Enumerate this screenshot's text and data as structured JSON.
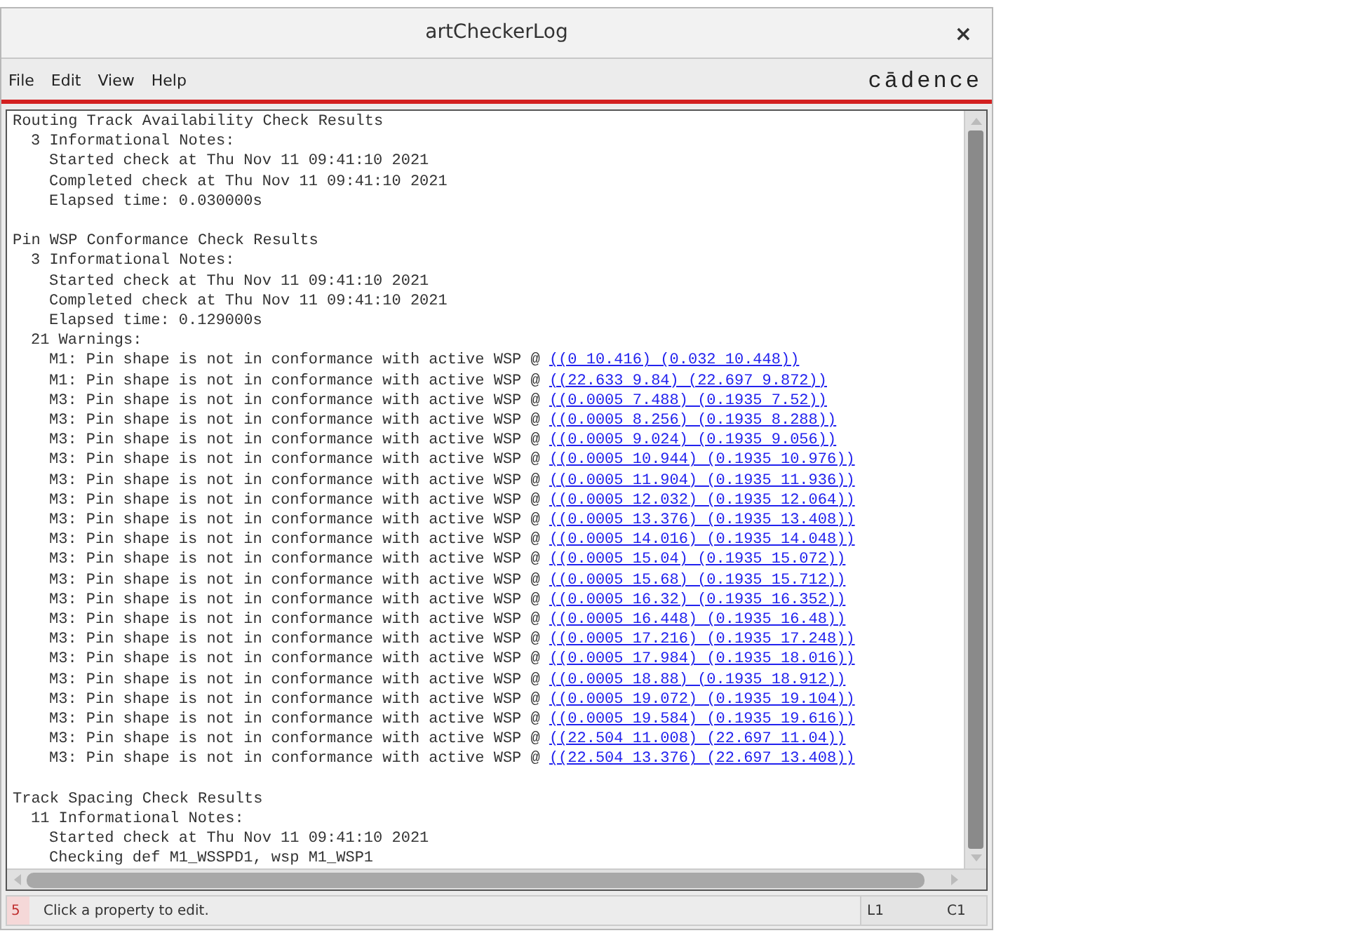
{
  "window": {
    "title": "artCheckerLog",
    "close": "×"
  },
  "menu": [
    {
      "label": "File"
    },
    {
      "label": "Edit"
    },
    {
      "label": "View"
    },
    {
      "label": "Help"
    }
  ],
  "logo": "cādence",
  "log": {
    "sections": [
      {
        "title": "Routing Track Availability Check Results",
        "groups": [
          {
            "heading": "3 Informational Notes:",
            "lines": [
              {
                "text": "Started check at Thu Nov 11 09:41:10 2021"
              },
              {
                "text": "Completed check at Thu Nov 11 09:41:10 2021"
              },
              {
                "text": "Elapsed time: 0.030000s"
              }
            ]
          }
        ]
      },
      {
        "title": "Pin WSP Conformance Check Results",
        "groups": [
          {
            "heading": "3 Informational Notes:",
            "lines": [
              {
                "text": "Started check at Thu Nov 11 09:41:10 2021"
              },
              {
                "text": "Completed check at Thu Nov 11 09:41:10 2021"
              },
              {
                "text": "Elapsed time: 0.129000s"
              }
            ]
          },
          {
            "heading": "21 Warnings:",
            "lines": [
              {
                "text": "M1: Pin shape is not in conformance with active WSP @",
                "link": "((0 10.416) (0.032 10.448))"
              },
              {
                "text": "M1: Pin shape is not in conformance with active WSP @",
                "link": "((22.633 9.84) (22.697 9.872))"
              },
              {
                "text": "M3: Pin shape is not in conformance with active WSP @",
                "link": "((0.0005 7.488) (0.1935 7.52))"
              },
              {
                "text": "M3: Pin shape is not in conformance with active WSP @",
                "link": "((0.0005 8.256) (0.1935 8.288))"
              },
              {
                "text": "M3: Pin shape is not in conformance with active WSP @",
                "link": "((0.0005 9.024) (0.1935 9.056))"
              },
              {
                "text": "M3: Pin shape is not in conformance with active WSP @",
                "link": "((0.0005 10.944) (0.1935 10.976))"
              },
              {
                "text": "M3: Pin shape is not in conformance with active WSP @",
                "link": "((0.0005 11.904) (0.1935 11.936))"
              },
              {
                "text": "M3: Pin shape is not in conformance with active WSP @",
                "link": "((0.0005 12.032) (0.1935 12.064))"
              },
              {
                "text": "M3: Pin shape is not in conformance with active WSP @",
                "link": "((0.0005 13.376) (0.1935 13.408))"
              },
              {
                "text": "M3: Pin shape is not in conformance with active WSP @",
                "link": "((0.0005 14.016) (0.1935 14.048))"
              },
              {
                "text": "M3: Pin shape is not in conformance with active WSP @",
                "link": "((0.0005 15.04) (0.1935 15.072))"
              },
              {
                "text": "M3: Pin shape is not in conformance with active WSP @",
                "link": "((0.0005 15.68) (0.1935 15.712))"
              },
              {
                "text": "M3: Pin shape is not in conformance with active WSP @",
                "link": "((0.0005 16.32) (0.1935 16.352))"
              },
              {
                "text": "M3: Pin shape is not in conformance with active WSP @",
                "link": "((0.0005 16.448) (0.1935 16.48))"
              },
              {
                "text": "M3: Pin shape is not in conformance with active WSP @",
                "link": "((0.0005 17.216) (0.1935 17.248))"
              },
              {
                "text": "M3: Pin shape is not in conformance with active WSP @",
                "link": "((0.0005 17.984) (0.1935 18.016))"
              },
              {
                "text": "M3: Pin shape is not in conformance with active WSP @",
                "link": "((0.0005 18.88) (0.1935 18.912))"
              },
              {
                "text": "M3: Pin shape is not in conformance with active WSP @",
                "link": "((0.0005 19.072) (0.1935 19.104))"
              },
              {
                "text": "M3: Pin shape is not in conformance with active WSP @",
                "link": "((0.0005 19.584) (0.1935 19.616))"
              },
              {
                "text": "M3: Pin shape is not in conformance with active WSP @",
                "link": "((22.504 11.008) (22.697 11.04))"
              },
              {
                "text": "M3: Pin shape is not in conformance with active WSP @",
                "link": "((22.504 13.376) (22.697 13.408))"
              }
            ]
          }
        ]
      },
      {
        "title": "Track Spacing Check Results",
        "groups": [
          {
            "heading": "11 Informational Notes:",
            "lines": [
              {
                "text": "Started check at Thu Nov 11 09:41:10 2021"
              },
              {
                "text": "Checking def M1_WSSPD1, wsp M1_WSP1"
              }
            ]
          }
        ]
      }
    ]
  },
  "status_bar": {
    "number": "5",
    "message": "Click a property to edit.",
    "line": "L1",
    "column": "C1"
  }
}
